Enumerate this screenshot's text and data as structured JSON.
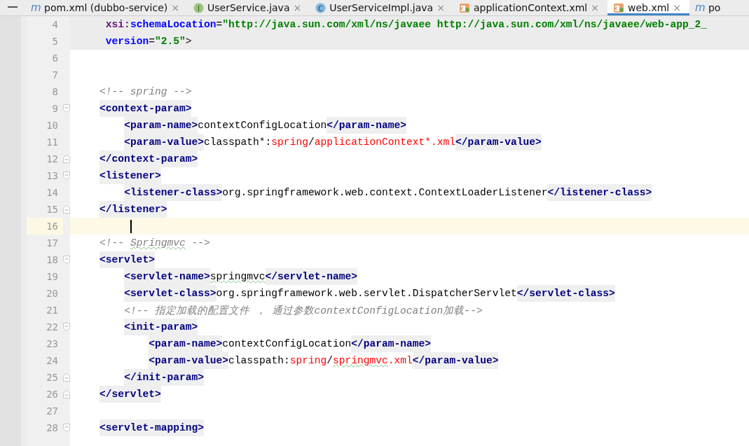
{
  "tabs": [
    {
      "label": "pom.xml (dubbo-service)",
      "kind": "maven",
      "icon_letter": "m",
      "selected": false,
      "close": "×"
    },
    {
      "label": "UserService.java",
      "kind": "interface",
      "icon_letter": "I",
      "selected": false,
      "close": "×"
    },
    {
      "label": "UserServiceImpl.java",
      "kind": "class",
      "icon_letter": "C",
      "selected": false,
      "close": "×"
    },
    {
      "label": "applicationContext.xml",
      "kind": "xml",
      "selected": false,
      "close": "×"
    },
    {
      "label": "web.xml",
      "kind": "xml",
      "selected": true,
      "close": "×"
    },
    {
      "label": "po",
      "kind": "maven",
      "icon_letter": "m",
      "selected": false
    }
  ],
  "lines": [
    {
      "number": "4",
      "kind": "attribute",
      "tag_highlight": true,
      "current": false,
      "tokens": [
        {
          "kind": "ns",
          "text": "xsi:"
        },
        {
          "kind": "attr",
          "text": "schemaLocation"
        },
        {
          "kind": "text",
          "text": "="
        },
        {
          "kind": "value",
          "text": "\"http://java.sun.com/xml/ns/javaee http://java.sun.com/xml/ns/javaee/web-app_2_"
        }
      ]
    },
    {
      "number": "5",
      "kind": "attribute",
      "tag_highlight": true,
      "current": false,
      "tokens": [
        {
          "kind": "attr",
          "text": "version"
        },
        {
          "kind": "text",
          "text": "="
        },
        {
          "kind": "value",
          "text": "\"2.5\""
        },
        {
          "kind": "text",
          "text": ">"
        }
      ]
    },
    {
      "number": "6",
      "current": false
    },
    {
      "number": "7",
      "current": false
    },
    {
      "number": "8",
      "current": false,
      "tokens": [
        {
          "kind": "comment",
          "text": "<!-- spring -->"
        }
      ]
    },
    {
      "number": "9",
      "kind": "fold_start",
      "current": false,
      "tokens": [
        {
          "kind": "tag",
          "text": "<context-param>"
        }
      ],
      "children": [
        {
          "number": "10",
          "current": false,
          "tokens": [
            {
              "kind": "tag",
              "text": "<param-name>"
            },
            {
              "kind": "text",
              "text": "contextConfigLocation"
            },
            {
              "kind": "tag",
              "text": "</param-name>"
            }
          ]
        },
        {
          "number": "11",
          "current": false,
          "tokens": [
            {
              "kind": "tag",
              "text": "<param-value>"
            },
            {
              "kind": "text",
              "text": "classpath*:"
            },
            {
              "kind": "path",
              "text": "spring"
            },
            {
              "kind": "text",
              "text": "/"
            },
            {
              "kind": "path",
              "text": "applicationContext*.xml"
            },
            {
              "kind": "tag",
              "text": "</param-value>"
            }
          ]
        }
      ]
    },
    {
      "number": "12",
      "kind": "fold_end",
      "current": false,
      "tokens": [
        {
          "kind": "tag",
          "text": "</context-param>"
        }
      ]
    },
    {
      "number": "13",
      "kind": "fold_start",
      "current": false,
      "tokens": [
        {
          "kind": "tag",
          "text": "<listener>"
        }
      ],
      "children": [
        {
          "number": "14",
          "current": false,
          "tokens": [
            {
              "kind": "tag",
              "text": "<listener-class>"
            },
            {
              "kind": "text",
              "text": "org.springframework.web.context.ContextLoaderListener"
            },
            {
              "kind": "tag",
              "text": "</listener-class>"
            }
          ]
        }
      ]
    },
    {
      "number": "15",
      "kind": "fold_end",
      "current": false,
      "tokens": [
        {
          "kind": "tag",
          "text": "</listener>"
        }
      ]
    },
    {
      "number": "16",
      "kind": "caret",
      "current": true
    },
    {
      "number": "17",
      "current": false,
      "tokens": [
        {
          "kind": "comment",
          "text": "<!-- "
        },
        {
          "kind": "comment",
          "text": "Springmvc",
          "typo": true
        },
        {
          "kind": "comment",
          "text": " -->"
        }
      ]
    },
    {
      "number": "18",
      "kind": "fold_start",
      "current": false,
      "tokens": [
        {
          "kind": "tag",
          "text": "<servlet>"
        }
      ],
      "children": [
        {
          "number": "19",
          "current": false,
          "tokens": [
            {
              "kind": "tag",
              "text": "<servlet-name>"
            },
            {
              "kind": "text",
              "text": "springmvc",
              "typo": true
            },
            {
              "kind": "tag",
              "text": "</servlet-name>"
            }
          ]
        },
        {
          "number": "20",
          "current": false,
          "tokens": [
            {
              "kind": "tag",
              "text": "<servlet-class>"
            },
            {
              "kind": "text",
              "text": "org.springframework.web.servlet.DispatcherServlet"
            },
            {
              "kind": "tag",
              "text": "</servlet-class>"
            }
          ]
        },
        {
          "number": "21",
          "current": false,
          "tokens": [
            {
              "kind": "comment",
              "text": "<!-- 指定加载的配置文件 ， 通过参数contextConfigLocation加载-->"
            }
          ]
        },
        {
          "number": "22",
          "kind": "fold_start",
          "current": false,
          "tokens": [
            {
              "kind": "tag",
              "text": "<init-param>"
            }
          ],
          "children": [
            {
              "number": "23",
              "current": false,
              "tokens": [
                {
                  "kind": "tag",
                  "text": "<param-name>"
                },
                {
                  "kind": "text",
                  "text": "contextConfigLocation"
                },
                {
                  "kind": "tag",
                  "text": "</param-name>"
                }
              ]
            },
            {
              "number": "24",
              "current": false,
              "tokens": [
                {
                  "kind": "tag",
                  "text": "<param-value>"
                },
                {
                  "kind": "text",
                  "text": "classpath:"
                },
                {
                  "kind": "path",
                  "text": "spring"
                },
                {
                  "kind": "text",
                  "text": "/"
                },
                {
                  "kind": "path",
                  "text": "springmvc",
                  "typo": true
                },
                {
                  "kind": "path",
                  "text": ".xml"
                },
                {
                  "kind": "tag",
                  "text": "</param-value>"
                }
              ]
            }
          ]
        },
        {
          "number": "25",
          "kind": "fold_end",
          "current": false,
          "tokens": [
            {
              "kind": "tag",
              "text": "</init-param>"
            }
          ]
        }
      ]
    },
    {
      "number": "26",
      "kind": "fold_end",
      "current": false,
      "tokens": [
        {
          "kind": "tag",
          "text": "</servlet>"
        }
      ]
    },
    {
      "number": "27",
      "current": false
    },
    {
      "number": "28",
      "kind": "fold_start",
      "current": false,
      "tokens": [
        {
          "kind": "tag",
          "text": "<servlet-mapping>"
        }
      ]
    }
  ]
}
